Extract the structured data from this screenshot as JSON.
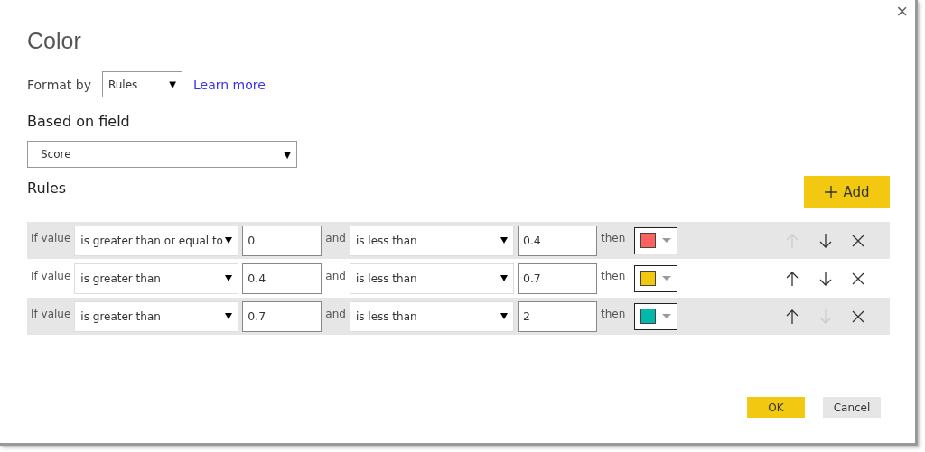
{
  "dialog": {
    "title": "Color",
    "close": "×"
  },
  "format_by": {
    "label": "Format by",
    "value": "Rules",
    "caret": "▼",
    "link": "Learn more"
  },
  "based_on_field": {
    "label": "Based on field",
    "value": "Score",
    "caret": "▼"
  },
  "rules": {
    "label": "Rules",
    "add_button": "Add",
    "rows": [
      {
        "prefix": "If value",
        "operator1": "is greater than or equal to",
        "value1": "0",
        "joiner": "and",
        "operator2": "is less than",
        "value2": "0.4",
        "then": "then",
        "color": "#fd625e",
        "up_enabled": false,
        "down_enabled": true
      },
      {
        "prefix": "If value",
        "operator1": "is greater than",
        "value1": "0.4",
        "joiner": "and",
        "operator2": "is less than",
        "value2": "0.7",
        "then": "then",
        "color": "#f2c80f",
        "up_enabled": true,
        "down_enabled": true
      },
      {
        "prefix": "If value",
        "operator1": "is greater than",
        "value1": "0.7",
        "joiner": "and",
        "operator2": "is less than",
        "value2": "2",
        "then": "then",
        "color": "#01b8aa",
        "up_enabled": true,
        "down_enabled": false
      }
    ]
  },
  "buttons": {
    "ok": "OK",
    "cancel": "Cancel"
  }
}
